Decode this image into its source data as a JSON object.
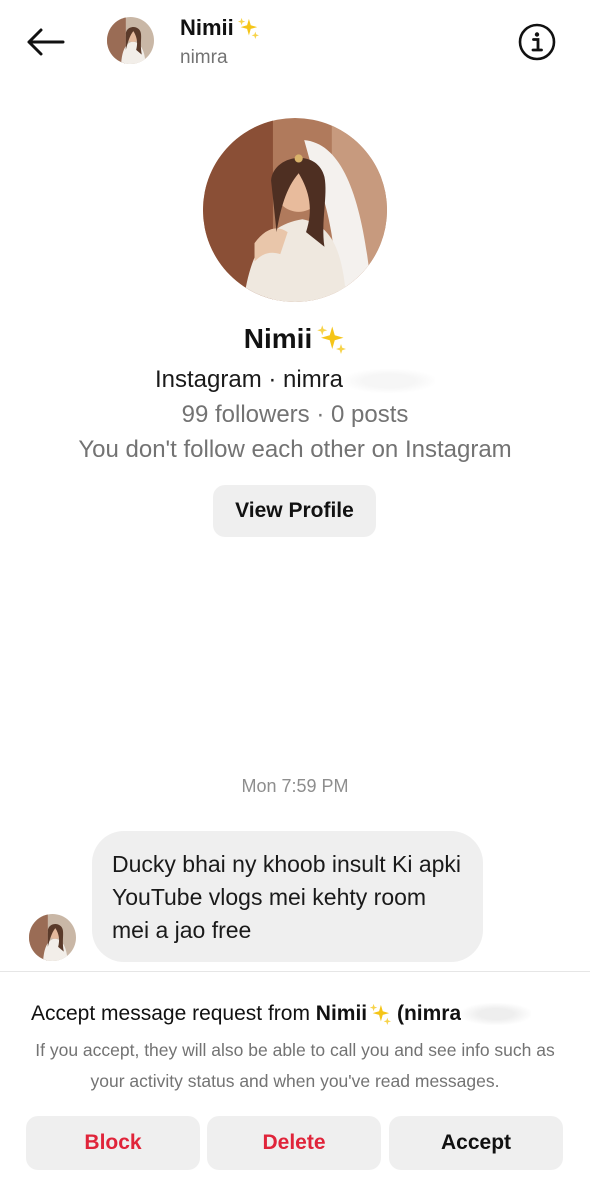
{
  "header": {
    "display_name": "Nimii",
    "username": "nimra",
    "back_icon": "arrow-left-icon",
    "info_icon": "info-icon"
  },
  "profile": {
    "name": "Nimii",
    "platform_line": "Instagram · nimra",
    "stats": "99 followers · 0 posts",
    "follow_status": "You don't follow each other on Instagram",
    "view_profile_label": "View Profile"
  },
  "chat": {
    "timestamp": "Mon 7:59 PM",
    "messages": [
      {
        "text": "Ducky bhai ny khoob insult Ki apki YouTube vlogs mei kehty room mei a jao free"
      }
    ]
  },
  "request": {
    "title_prefix": "Accept message request from ",
    "title_name": "Nimii",
    "title_handle": " (nimra",
    "description": "If you accept, they will also be able to call you and see info such as your activity status and when you've read messages.",
    "block_label": "Block",
    "delete_label": "Delete",
    "accept_label": "Accept"
  },
  "colors": {
    "destructive": "#e0243a",
    "sparkle": "#f5c518",
    "secondary_text": "#737373",
    "button_bg": "#efefef"
  }
}
